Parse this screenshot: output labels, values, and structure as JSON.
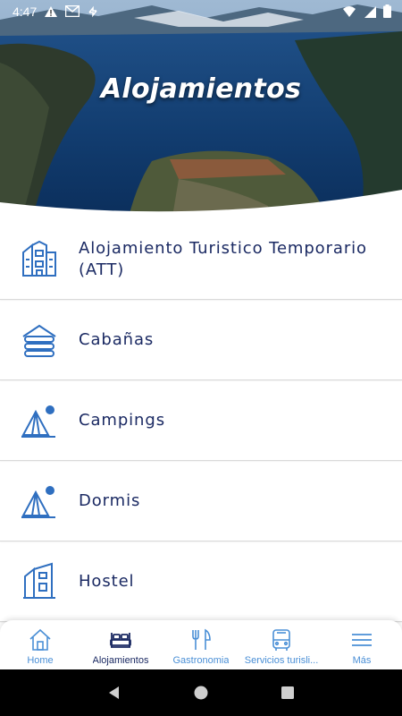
{
  "status_bar": {
    "time": "4:47",
    "icons_left": [
      "alert-icon",
      "gmail-icon",
      "sync-icon"
    ],
    "icons_right": [
      "wifi-icon",
      "signal-icon",
      "battery-icon"
    ]
  },
  "header": {
    "title": "Alojamientos"
  },
  "items": [
    {
      "label": "Alojamiento Turistico Temporario (ATT)",
      "icon": "building-icon"
    },
    {
      "label": "Cabañas",
      "icon": "cabin-icon"
    },
    {
      "label": "Campings",
      "icon": "tent-icon"
    },
    {
      "label": "Dormis",
      "icon": "tent-icon"
    },
    {
      "label": "Hostel",
      "icon": "hostel-icon"
    }
  ],
  "bottom_nav": [
    {
      "label": "Home",
      "icon": "home-icon",
      "active": false
    },
    {
      "label": "Alojamientos",
      "icon": "bed-icon",
      "active": true
    },
    {
      "label": "Gastronomia",
      "icon": "cutlery-icon",
      "active": false
    },
    {
      "label": "Servicios turisli...",
      "icon": "bus-icon",
      "active": false
    },
    {
      "label": "Más",
      "icon": "menu-icon",
      "active": false
    }
  ],
  "colors": {
    "primary": "#1b2a63",
    "accent": "#4a8fd6",
    "icon_blue": "#2f6fc0"
  }
}
